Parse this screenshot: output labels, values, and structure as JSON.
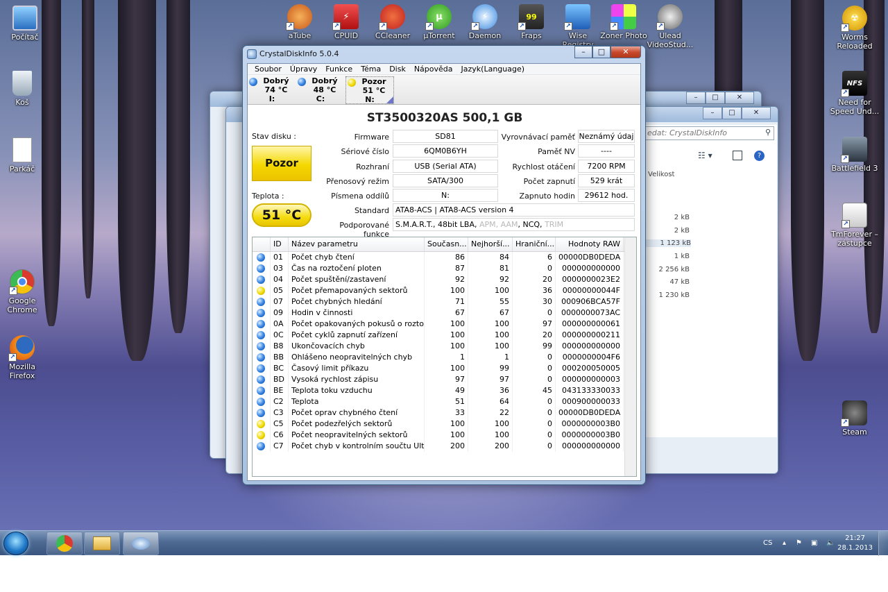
{
  "desktop": {
    "icons_left": [
      {
        "label": "Počítač",
        "icon": "computer-icon"
      },
      {
        "label": "Koš",
        "icon": "recycle-bin-icon"
      },
      {
        "label": "Parkáč",
        "icon": "document-icon"
      },
      {
        "label": "Google Chrome",
        "icon": "chrome-icon"
      },
      {
        "label": "Mozilla Firefox",
        "icon": "firefox-icon"
      }
    ],
    "icons_top": [
      {
        "label": "aTube",
        "icon": "atube-icon"
      },
      {
        "label": "CPUID",
        "icon": "cpuid-icon"
      },
      {
        "label": "CCleaner",
        "icon": "ccleaner-icon"
      },
      {
        "label": "µTorrent",
        "icon": "utorrent-icon"
      },
      {
        "label": "Daemon",
        "icon": "daemon-icon"
      },
      {
        "label": "Fraps",
        "icon": "fraps-icon"
      },
      {
        "label": "Wise Registry",
        "icon": "wise-registry-icon"
      },
      {
        "label": "Zoner Photo",
        "icon": "zoner-photo-icon"
      },
      {
        "label": "Ulead VideoStud...",
        "icon": "ulead-icon"
      }
    ],
    "icons_right": [
      {
        "label": "Worms Reloaded",
        "icon": "worms-icon"
      },
      {
        "label": "Need for Speed Und...",
        "icon": "nfs-icon"
      },
      {
        "label": "Battlefield 3",
        "icon": "battlefield-icon"
      },
      {
        "label": "TmForever – zástupce",
        "icon": "trackmania-icon"
      },
      {
        "label": "Steam",
        "icon": "steam-icon"
      }
    ]
  },
  "explorer": {
    "search_placeholder": "edat: CrystalDiskInfo",
    "column_size": "Velikost",
    "sizes": [
      "2 kB",
      "2 kB",
      "1 123 kB",
      "1 kB",
      "2 256 kB",
      "47 kB",
      "1 230 kB"
    ]
  },
  "window": {
    "title": "CrystalDiskInfo 5.0.4",
    "menu": [
      "Soubor",
      "Úpravy",
      "Funkce",
      "Téma",
      "Disk",
      "Nápověda",
      "Jazyk(Language)"
    ],
    "disks": [
      {
        "status": "Dobrý",
        "temp": "74 °C",
        "letter": "I:",
        "color": "blue"
      },
      {
        "status": "Dobrý",
        "temp": "48 °C",
        "letter": "C:",
        "color": "blue"
      },
      {
        "status": "Pozor",
        "temp": "51 °C",
        "letter": "N:",
        "color": "yellow"
      }
    ],
    "model": "ST3500320AS  500,1 GB",
    "health_label": "Stav disku :",
    "health_value": "Pozor",
    "temp_label": "Teplota :",
    "temp_value": "51 °C",
    "info": {
      "firmware_label": "Firmware",
      "firmware": "SD81",
      "serial_label": "Sériové číslo",
      "serial": "6QM0B6YH",
      "interface_label": "Rozhraní",
      "interface": "USB (Serial ATA)",
      "transfer_label": "Přenosový režim",
      "transfer": "SATA/300",
      "letters_label": "Písmena oddílů",
      "letters": "N:",
      "buffer_label": "Vyrovnávací paměť",
      "buffer": "Neznámý údaj",
      "nv_label": "Paměť NV",
      "nv": "----",
      "rpm_label": "Rychlost otáčení",
      "rpm": "7200 RPM",
      "power_count_label": "Počet zapnutí",
      "power_count": "529 krát",
      "power_hours_label": "Zapnuto hodin",
      "power_hours": "29612 hod.",
      "standard_label": "Standard",
      "standard": "ATA8-ACS | ATA8-ACS version 4",
      "features_label": "Podporované funkce",
      "features_active_1": "S.M.A.R.T., 48bit LBA, ",
      "features_inactive_1": "APM",
      "features_sep_1": ", ",
      "features_inactive_2": "AAM",
      "features_active_2": ", NCQ, ",
      "features_inactive_3": "TRIM"
    },
    "table_headers": [
      "",
      "ID",
      "Název parametru",
      "Současn...",
      "Nejhorší...",
      "Hraniční...",
      "Hodnoty RAW"
    ],
    "rows": [
      {
        "s": "blue",
        "id": "01",
        "name": "Počet chyb čtení",
        "cur": "86",
        "worst": "84",
        "thr": "6",
        "raw": "00000DB0DEDA"
      },
      {
        "s": "blue",
        "id": "03",
        "name": "Čas na roztočení ploten",
        "cur": "87",
        "worst": "81",
        "thr": "0",
        "raw": "000000000000"
      },
      {
        "s": "blue",
        "id": "04",
        "name": "Počet spuštění/zastavení",
        "cur": "92",
        "worst": "92",
        "thr": "20",
        "raw": "0000000023E2"
      },
      {
        "s": "yellow",
        "id": "05",
        "name": "Počet přemapovaných sektorů",
        "cur": "100",
        "worst": "100",
        "thr": "36",
        "raw": "00000000044F"
      },
      {
        "s": "blue",
        "id": "07",
        "name": "Počet chybných hledání",
        "cur": "71",
        "worst": "55",
        "thr": "30",
        "raw": "000906BCA57F"
      },
      {
        "s": "blue",
        "id": "09",
        "name": "Hodin v činnosti",
        "cur": "67",
        "worst": "67",
        "thr": "0",
        "raw": "0000000073AC"
      },
      {
        "s": "blue",
        "id": "0A",
        "name": "Počet opakovaných pokusů o rozto...",
        "cur": "100",
        "worst": "100",
        "thr": "97",
        "raw": "000000000061"
      },
      {
        "s": "blue",
        "id": "0C",
        "name": "Počet cyklů zapnutí zařízení",
        "cur": "100",
        "worst": "100",
        "thr": "20",
        "raw": "000000000211"
      },
      {
        "s": "blue",
        "id": "B8",
        "name": "Ukončovacích chyb",
        "cur": "100",
        "worst": "100",
        "thr": "99",
        "raw": "000000000000"
      },
      {
        "s": "blue",
        "id": "BB",
        "name": "Ohlášeno neopravitelných chyb",
        "cur": "1",
        "worst": "1",
        "thr": "0",
        "raw": "0000000004F6"
      },
      {
        "s": "blue",
        "id": "BC",
        "name": "Časový limit příkazu",
        "cur": "100",
        "worst": "99",
        "thr": "0",
        "raw": "000200050005"
      },
      {
        "s": "blue",
        "id": "BD",
        "name": "Vysoká rychlost zápisu",
        "cur": "97",
        "worst": "97",
        "thr": "0",
        "raw": "000000000003"
      },
      {
        "s": "blue",
        "id": "BE",
        "name": "Teplota toku vzduchu",
        "cur": "49",
        "worst": "36",
        "thr": "45",
        "raw": "043133330033"
      },
      {
        "s": "blue",
        "id": "C2",
        "name": "Teplota",
        "cur": "51",
        "worst": "64",
        "thr": "0",
        "raw": "000900000033"
      },
      {
        "s": "blue",
        "id": "C3",
        "name": "Počet oprav chybného čtení",
        "cur": "33",
        "worst": "22",
        "thr": "0",
        "raw": "00000DB0DEDA"
      },
      {
        "s": "yellow",
        "id": "C5",
        "name": "Počet podezřelých sektorů",
        "cur": "100",
        "worst": "100",
        "thr": "0",
        "raw": "0000000003B0"
      },
      {
        "s": "yellow",
        "id": "C6",
        "name": "Počet neopravitelných sektorů",
        "cur": "100",
        "worst": "100",
        "thr": "0",
        "raw": "0000000003B0"
      },
      {
        "s": "blue",
        "id": "C7",
        "name": "Počet chyb v kontrolním součtu Ultr...",
        "cur": "200",
        "worst": "200",
        "thr": "0",
        "raw": "000000000000"
      }
    ]
  },
  "taskbar": {
    "language": "CS",
    "time": "21:27",
    "date": "28.1.2013",
    "apps": [
      "chrome-icon",
      "explorer-icon",
      "crystaldiskinfo-icon"
    ]
  }
}
